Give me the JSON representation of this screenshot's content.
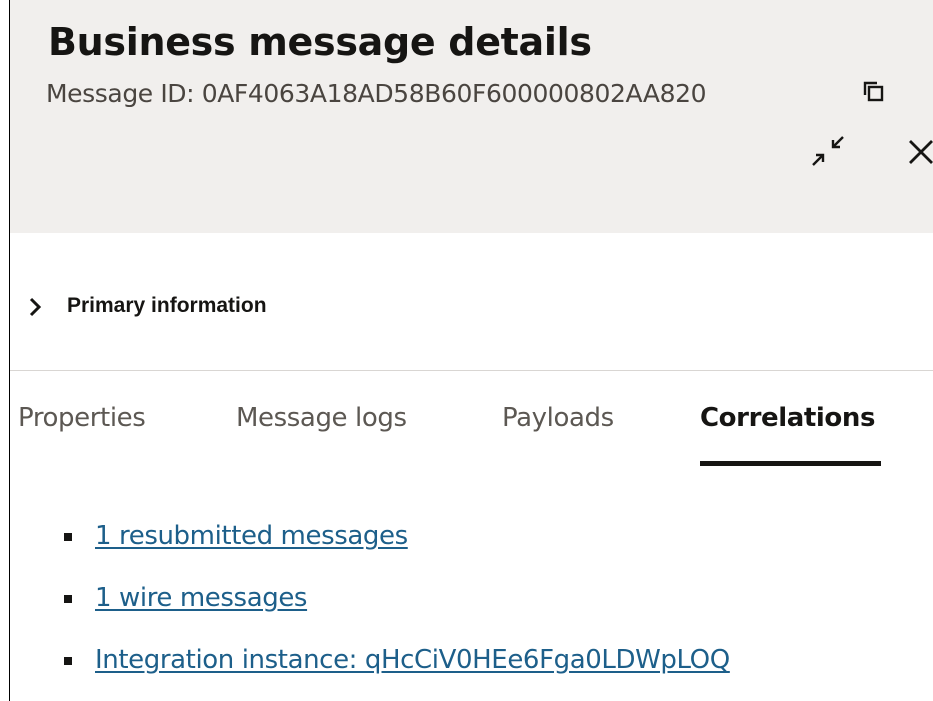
{
  "panel": {
    "title": "Business message details",
    "subtitle": "Message ID: 0AF4063A18AD58B60F600000802AA820",
    "copy_icon": "copy-icon",
    "minimize_icon": "minimize-icon",
    "close_icon": "close-icon"
  },
  "primary_section": {
    "label": "Primary information",
    "expanded": false,
    "chevron_icon": "chevron-right-icon"
  },
  "tabs": [
    {
      "label": "Properties",
      "active": false
    },
    {
      "label": "Message logs",
      "active": false
    },
    {
      "label": "Payloads",
      "active": false
    },
    {
      "label": "Correlations",
      "active": true
    }
  ],
  "correlations": [
    {
      "label": "1 resubmitted messages"
    },
    {
      "label": "1 wire messages"
    },
    {
      "label": "Integration instance: qHcCiV0HEe6Fga0LDWpLOQ"
    }
  ],
  "colors": {
    "header_bg": "#f1efed",
    "link": "#1d5f8a",
    "text": "#161513",
    "muted_text": "#5c5853"
  }
}
